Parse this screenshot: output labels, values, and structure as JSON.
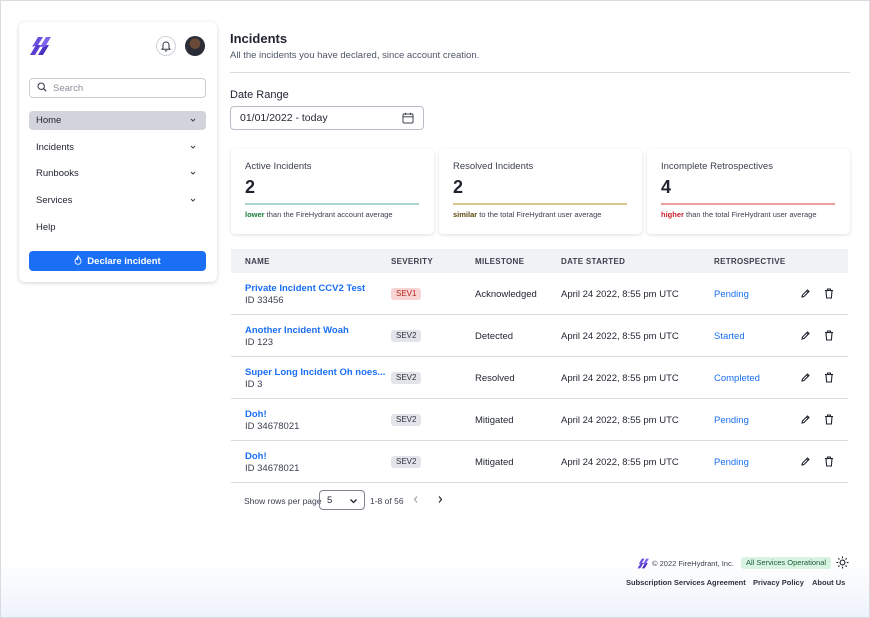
{
  "sidebar": {
    "search_placeholder": "Search",
    "nav": [
      {
        "label": "Home"
      },
      {
        "label": "Incidents"
      },
      {
        "label": "Runbooks"
      },
      {
        "label": "Services"
      },
      {
        "label": "Help"
      }
    ],
    "declare_label": "Declare incident"
  },
  "header": {
    "title": "Incidents",
    "subtitle": "All the incidents you have declared, since account creation."
  },
  "date_range": {
    "label": "Date Range",
    "value": "01/01/2022 - today"
  },
  "cards": [
    {
      "label": "Active Incidents",
      "value": "2",
      "emph": "lower",
      "note": " than the FireHydrant account average",
      "bar_color": "#a9d6cf",
      "emph_color": "#1b7a3a"
    },
    {
      "label": "Resolved Incidents",
      "value": "2",
      "emph": "similar",
      "note": " to the total FireHydrant user average",
      "bar_color": "#d8c98e",
      "emph_color": "#5a4a10"
    },
    {
      "label": "Incomplete Retrospectives",
      "value": "4",
      "emph": "higher",
      "note": " than the total FireHydrant user average",
      "bar_color": "#ef9fa0",
      "emph_color": "#c8202a"
    }
  ],
  "table": {
    "columns": [
      "NAME",
      "SEVERITY",
      "MILESTONE",
      "DATE STARTED",
      "RETROSPECTIVE"
    ],
    "rows": [
      {
        "name": "Private Incident CCV2 Test",
        "id": "ID 33456",
        "severity": "SEV1",
        "milestone": "Acknowledged",
        "date": "April 24 2022, 8:55 pm UTC",
        "retro": "Pending"
      },
      {
        "name": "Another Incident Woah",
        "id": "ID 123",
        "severity": "SEV2",
        "milestone": "Detected",
        "date": "April 24 2022, 8:55 pm UTC",
        "retro": "Started"
      },
      {
        "name": "Super Long Incident Oh noes...",
        "id": "ID 3",
        "severity": "SEV2",
        "milestone": "Resolved",
        "date": "April 24 2022, 8:55 pm UTC",
        "retro": "Completed"
      },
      {
        "name": "Doh!",
        "id": "ID 34678021",
        "severity": "SEV2",
        "milestone": "Mitigated",
        "date": "April 24 2022, 8:55 pm UTC",
        "retro": "Pending"
      },
      {
        "name": "Doh!",
        "id": "ID 34678021",
        "severity": "SEV2",
        "milestone": "Mitigated",
        "date": "April 24 2022, 8:55 pm UTC",
        "retro": "Pending"
      }
    ]
  },
  "pagination": {
    "rows_label": "Show rows per page",
    "rows_value": "5",
    "range": "1-8 of 56"
  },
  "footer": {
    "copyright": "© 2022 FireHydrant, Inc.",
    "status": "All Services Operational",
    "links": [
      "Subscription Services Agreement",
      "Privacy Policy",
      "About Us"
    ]
  },
  "colors": {
    "accent": "#1a6ff5",
    "brand": "#5a3fd1",
    "sev1_bg": "#f8d3d3",
    "sev1_fg": "#b3261e",
    "sev2_bg": "#e2e4e9",
    "sev2_fg": "#2d3240"
  },
  "icons": [
    "firehydrant-logo-icon",
    "bell-icon",
    "search-icon",
    "chevron-down-icon",
    "fire-icon",
    "calendar-icon",
    "pencil-icon",
    "trash-icon",
    "chevron-left-icon",
    "chevron-right-icon",
    "sun-icon"
  ]
}
